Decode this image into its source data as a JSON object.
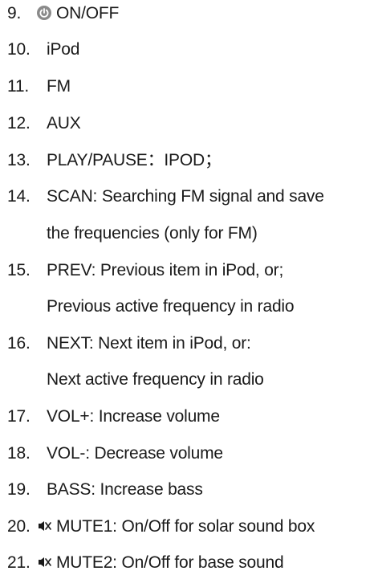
{
  "items": [
    {
      "num": "9.",
      "text": "ON/OFF",
      "icon": "power-icon"
    },
    {
      "num": "10.",
      "text": "iPod"
    },
    {
      "num": "11.",
      "text": "FM"
    },
    {
      "num": "12.",
      "text": "AUX"
    },
    {
      "num": "13.",
      "text": "PLAY/PAUSE：IPOD；"
    },
    {
      "num": "14.",
      "text": "SCAN: Searching FM signal and save",
      "cont": "the frequencies (only for FM)"
    },
    {
      "num": "15.",
      "text": "PREV: Previous item in iPod, or;",
      "cont": "Previous active frequency in radio"
    },
    {
      "num": "16.",
      "text": "NEXT: Next item in iPod, or:",
      "cont": "Next active frequency in radio"
    },
    {
      "num": "17.",
      "text": "VOL+: Increase volume"
    },
    {
      "num": "18.",
      "text": "VOL-: Decrease volume"
    },
    {
      "num": "19.",
      "text": "BASS: Increase bass"
    },
    {
      "num": "20.",
      "text": "MUTE1: On/Off for solar sound box",
      "icon": "mute-icon"
    },
    {
      "num": "21.",
      "text": "MUTE2: On/Off for base sound",
      "icon": "mute-icon"
    }
  ]
}
